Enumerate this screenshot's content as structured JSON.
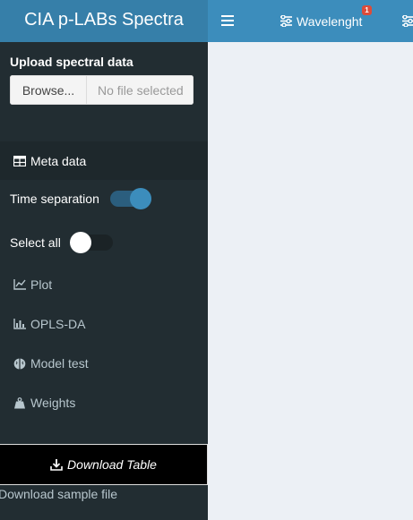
{
  "header": {
    "app_title": "CIA p-LABs Spectra",
    "nav_items": [
      {
        "label": "Wavelenght",
        "badge": "1"
      }
    ]
  },
  "sidebar": {
    "upload_label": "Upload spectral data",
    "browse_label": "Browse...",
    "file_placeholder": "No file selected",
    "active_item": "Meta data",
    "time_separation_label": "Time separation",
    "time_separation_on": true,
    "select_all_label": "Select all",
    "select_all_on": false,
    "menu_items": [
      {
        "label": "Plot",
        "icon": "line-chart-icon"
      },
      {
        "label": "OPLS-DA",
        "icon": "bar-chart-icon"
      },
      {
        "label": "Model test",
        "icon": "brain-icon"
      },
      {
        "label": "Weights",
        "icon": "weight-icon"
      }
    ],
    "download_table_label": "Download Table",
    "download_sample_label": "Download sample file"
  },
  "colors": {
    "header_logo_bg": "#367fa9",
    "navbar_bg": "#3c8dbc",
    "sidebar_bg": "#222d32",
    "content_bg": "#ecf0f5",
    "badge_bg": "#dd4b39"
  }
}
